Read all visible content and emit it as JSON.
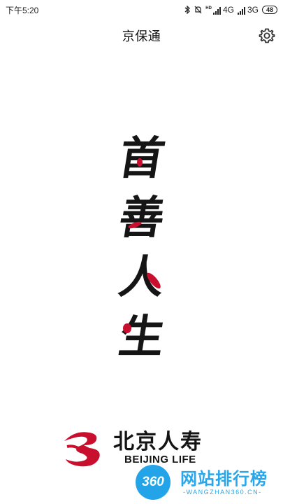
{
  "status_bar": {
    "time": "下午5:20",
    "hd": "HD",
    "network_1": "4G",
    "network_2": "3G",
    "battery": "48"
  },
  "header": {
    "title": "京保通",
    "settings_icon": "gear-icon"
  },
  "splash": {
    "calligraphy": [
      "首",
      "善",
      "人",
      "生"
    ],
    "accent_color": "#c8102e"
  },
  "logo": {
    "chinese_name": "北京人寿",
    "english_name": "BEIJING LIFE"
  },
  "watermark": {
    "badge": "360",
    "name": "网站排行榜",
    "url": "-WANGZHAN360.CN-"
  }
}
